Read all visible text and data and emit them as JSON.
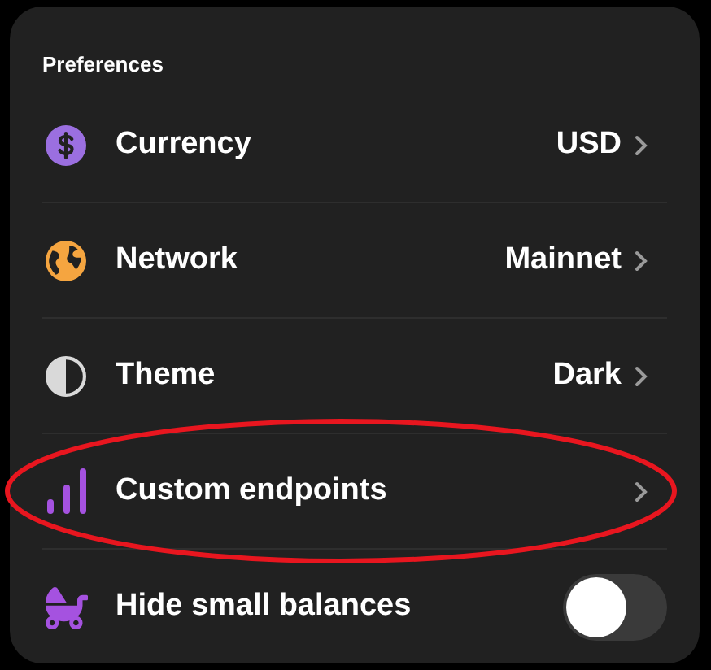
{
  "section": {
    "title": "Preferences"
  },
  "items": [
    {
      "kind": "link",
      "color": "#9b6fe0",
      "label": "Currency",
      "value": "USD",
      "circled": false
    },
    {
      "kind": "link",
      "color": "#f5a540",
      "label": "Network",
      "value": "Mainnet",
      "circled": false
    },
    {
      "kind": "link",
      "color": "#d9d9d9",
      "label": "Theme",
      "value": "Dark",
      "circled": false
    },
    {
      "kind": "link",
      "color": "#a552e0",
      "label": "Custom endpoints",
      "circled": true
    },
    {
      "kind": "toggle",
      "color": "#a552e0",
      "label": "Hide small balances",
      "on": false,
      "circled": false
    }
  ]
}
